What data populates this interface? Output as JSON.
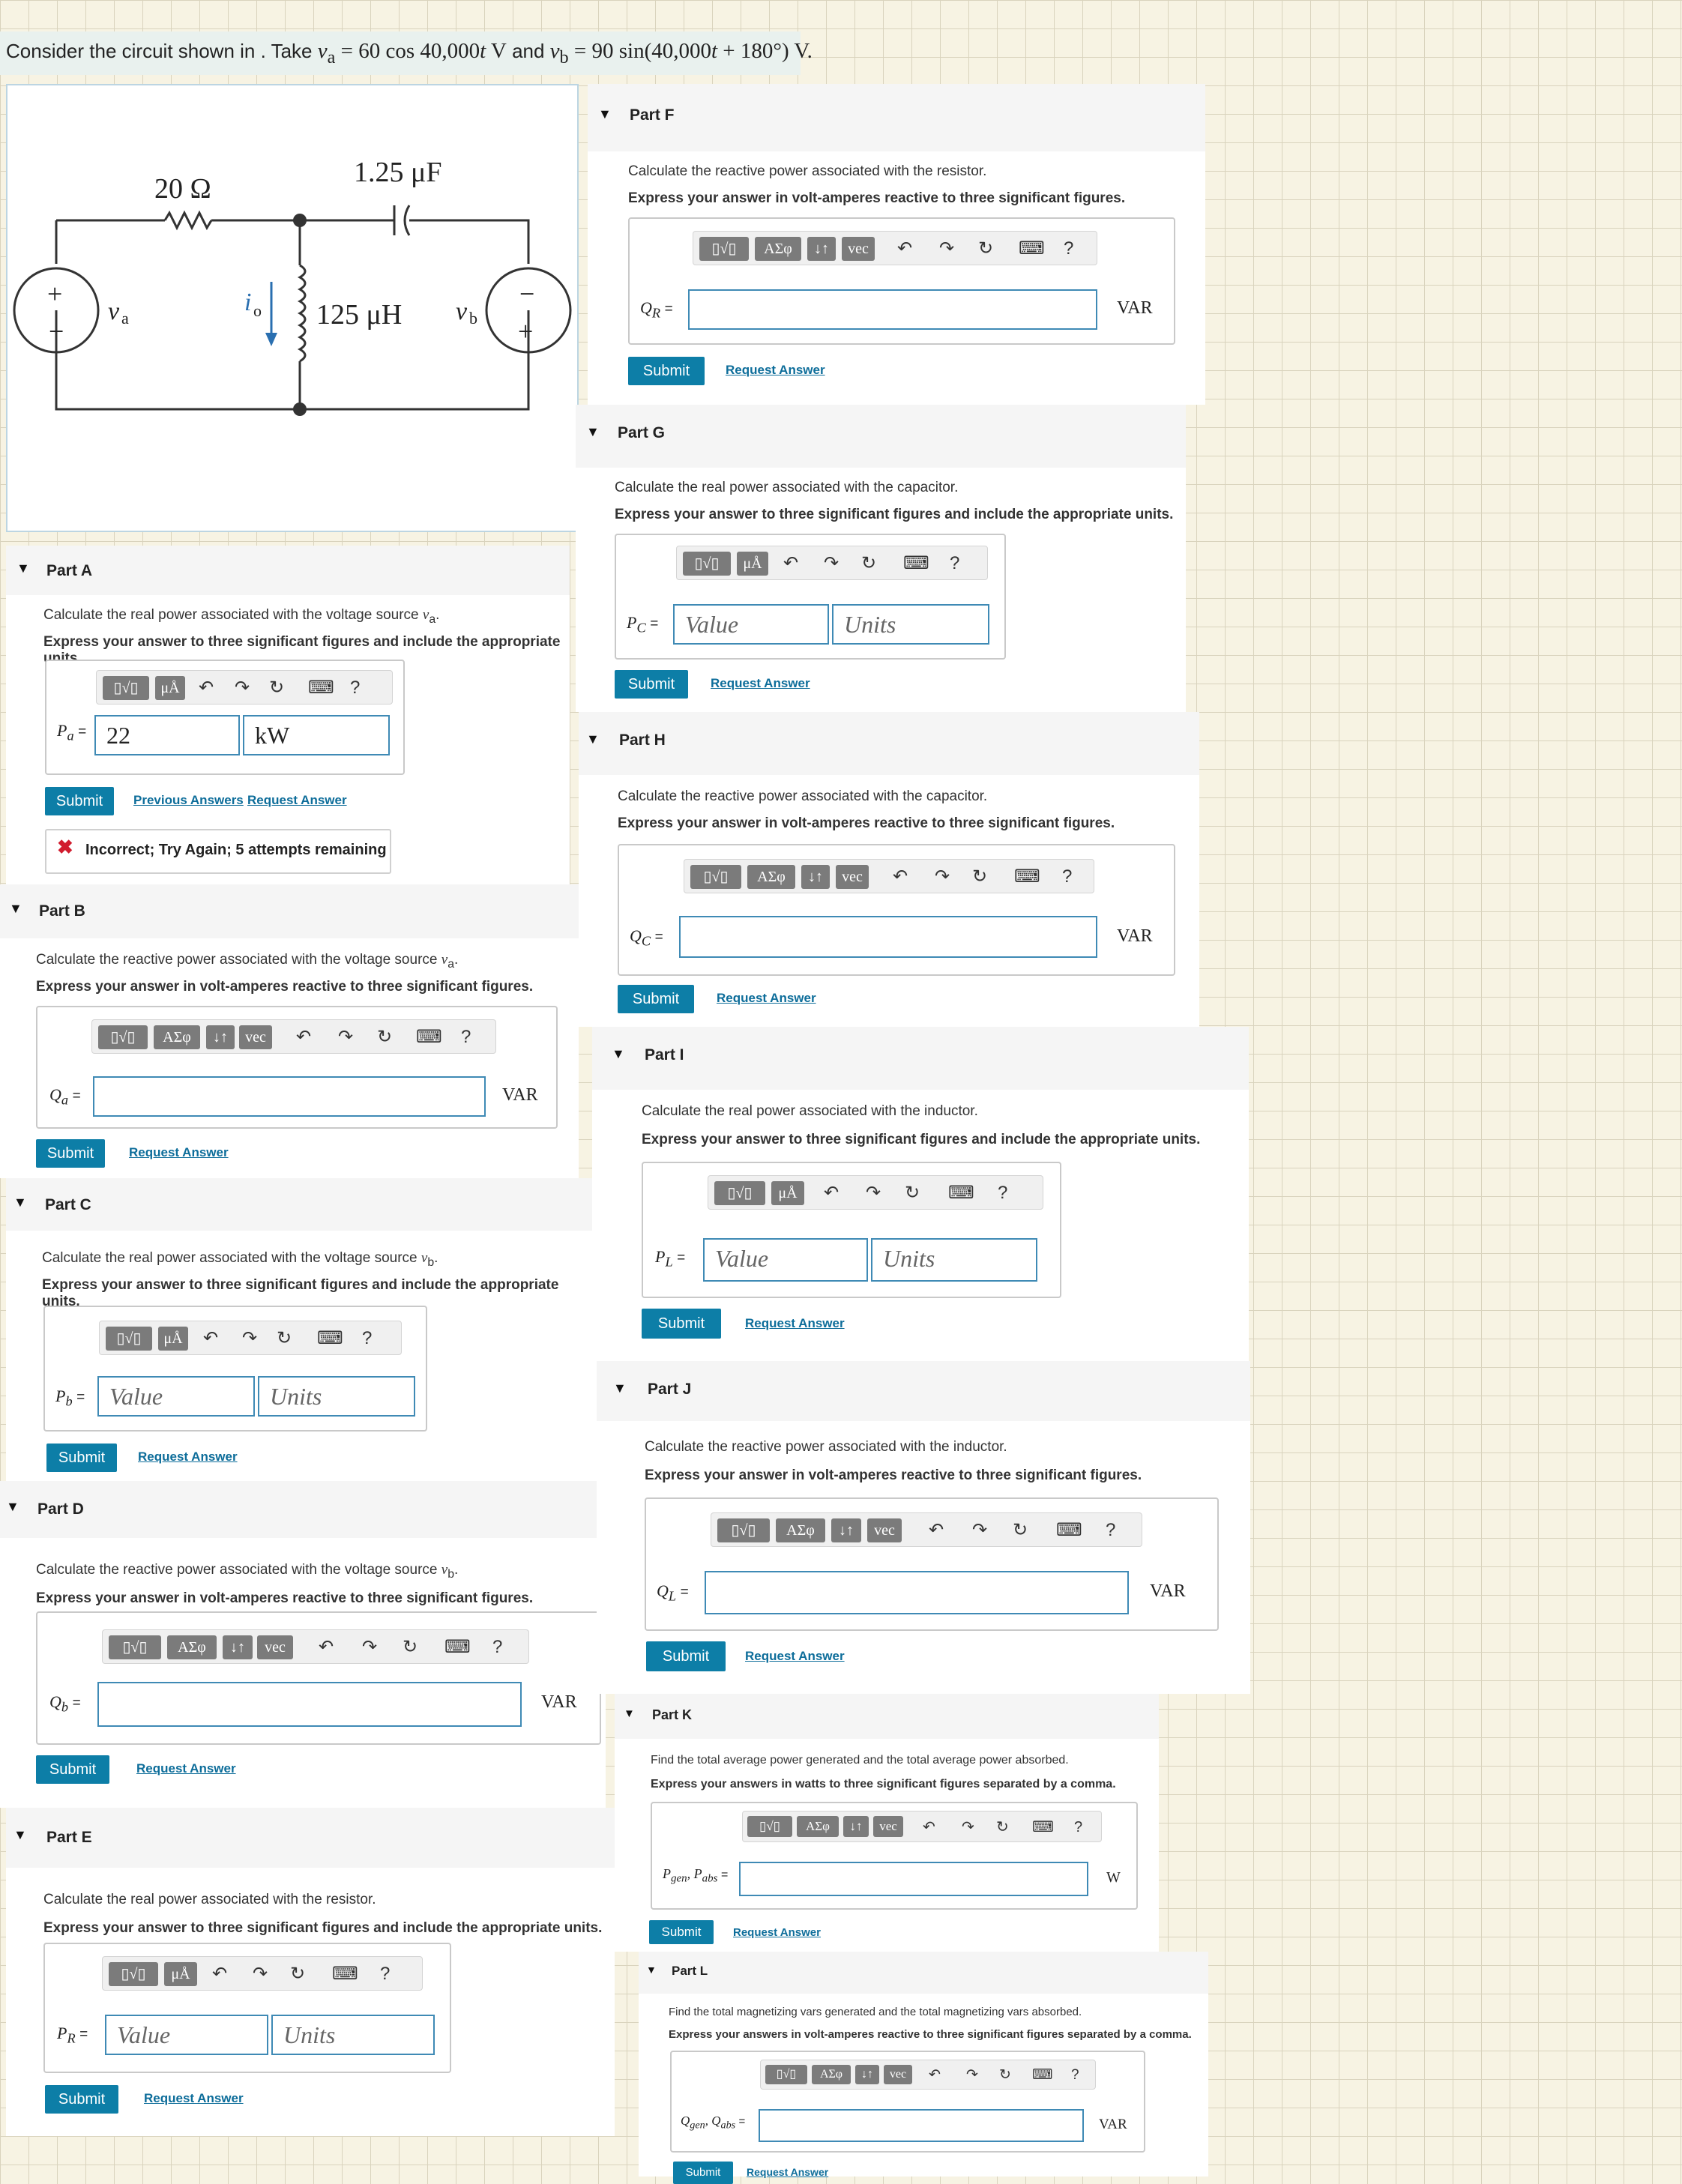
{
  "intro": {
    "text_prefix": "Consider the circuit shown in . Take ",
    "va_sym": "v",
    "va_sub": "a",
    "va_eq": " = 60 cos 40,000",
    "t1": "t",
    "va_unit": " V",
    "and": " and ",
    "vb_sym": "v",
    "vb_sub": "b",
    "vb_eq": " = 90 sin(40,000",
    "t2": "t",
    "vb_tail": " + 180°) V."
  },
  "figure": {
    "resistor": "20 Ω",
    "capacitor": "1.25 μF",
    "inductor": "125 μH",
    "source_a": "v",
    "source_a_sub": "a",
    "source_b": "v",
    "source_b_sub": "b",
    "current": "i",
    "current_sub": "o",
    "plus": "+",
    "minus": "−"
  },
  "toolbar": {
    "templates": "▯√▯",
    "greek": "ΑΣφ",
    "swap": "↓↑",
    "vec": "vec",
    "units": "μÅ",
    "help": "?"
  },
  "common": {
    "submit": "Submit",
    "request": "Request Answer",
    "previous": "Previous Answers",
    "value_ph": "Value",
    "units_ph": "Units",
    "var": "VAR",
    "w": "W",
    "eq": "="
  },
  "parts": {
    "A": {
      "title": "Part A",
      "question": "Calculate the real power associated with the voltage source",
      "sym": "v",
      "sub": "a",
      "instruction": "Express your answer to three significant figures and include the appropriate units.",
      "label": "P",
      "label_sub": "a",
      "value": "22",
      "units": "kW",
      "feedback": "Incorrect; Try Again; 5 attempts remaining"
    },
    "B": {
      "title": "Part B",
      "question": "Calculate the reactive power associated with the voltage source",
      "sym": "v",
      "sub": "a",
      "instruction": "Express your answer in volt-amperes reactive to three significant figures.",
      "label": "Q",
      "label_sub": "a"
    },
    "C": {
      "title": "Part C",
      "question": "Calculate the real power associated with the voltage source",
      "sym": "v",
      "sub": "b",
      "instruction": "Express your answer to three significant figures and include the appropriate units.",
      "label": "P",
      "label_sub": "b"
    },
    "D": {
      "title": "Part D",
      "question": "Calculate the reactive power associated with the voltage source",
      "sym": "v",
      "sub": "b",
      "instruction": "Express your answer in volt-amperes reactive to three significant figures.",
      "label": "Q",
      "label_sub": "b"
    },
    "E": {
      "title": "Part E",
      "question": "Calculate the real power associated with the resistor.",
      "instruction": "Express your answer to three significant figures and include the appropriate units.",
      "label": "P",
      "label_sub": "R"
    },
    "F": {
      "title": "Part F",
      "question": "Calculate the reactive power associated with the resistor.",
      "instruction": "Express your answer in volt-amperes reactive to three significant figures.",
      "label": "Q",
      "label_sub": "R"
    },
    "G": {
      "title": "Part G",
      "question": "Calculate the real power associated with the capacitor.",
      "instruction": "Express your answer to three significant figures and include the appropriate units.",
      "label": "P",
      "label_sub": "C"
    },
    "H": {
      "title": "Part H",
      "question": "Calculate the reactive power associated with the capacitor.",
      "instruction": "Express your answer in volt-amperes reactive to three significant figures.",
      "label": "Q",
      "label_sub": "C"
    },
    "I": {
      "title": "Part I",
      "question": "Calculate the real power associated with the inductor.",
      "instruction": "Express your answer to three significant figures and include the appropriate units.",
      "label": "P",
      "label_sub": "L"
    },
    "J": {
      "title": "Part J",
      "question": "Calculate the reactive power associated with the inductor.",
      "instruction": "Express your answer in volt-amperes reactive to three significant figures.",
      "label": "Q",
      "label_sub": "L"
    },
    "K": {
      "title": "Part K",
      "question": "Find the total average power generated and the total average power absorbed.",
      "instruction": "Express your answers in watts to three significant figures separated by a comma.",
      "label1": "P",
      "sub1": "gen",
      "label2": "P",
      "sub2": "abs"
    },
    "L": {
      "title": "Part L",
      "question": "Find the total magnetizing vars generated and the total magnetizing vars absorbed.",
      "instruction": "Express your answers in volt-amperes reactive to three significant figures separated by a comma.",
      "label1": "Q",
      "sub1": "gen",
      "label2": "Q",
      "sub2": "abs"
    }
  }
}
